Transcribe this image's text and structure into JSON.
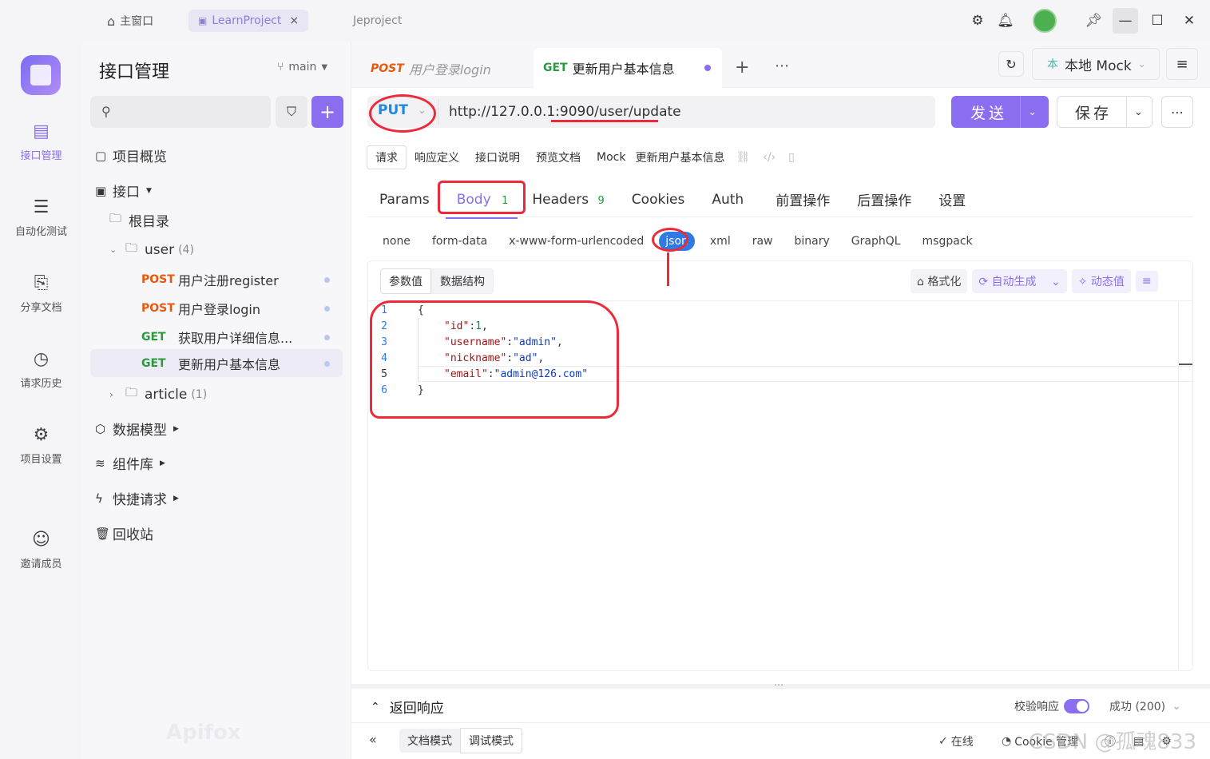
{
  "topbar": {
    "home_label": "主窗口",
    "project_tab": "LearnProject",
    "project_tab_close": "×",
    "project_name": "Jeproject"
  },
  "rail": [
    {
      "label": "接口管理",
      "icon": "api-management-icon"
    },
    {
      "label": "自动化测试",
      "icon": "automation-icon"
    },
    {
      "label": "分享文档",
      "icon": "share-doc-icon"
    },
    {
      "label": "请求历史",
      "icon": "history-icon"
    },
    {
      "label": "项目设置",
      "icon": "settings-icon"
    },
    {
      "label": "邀请成员",
      "icon": "invite-icon"
    }
  ],
  "sidebar": {
    "title": "接口管理",
    "branch": "main",
    "overview": "项目概览",
    "interfaces": "接口",
    "root": "根目录",
    "user_folder": "user",
    "user_count": "(4)",
    "items": [
      {
        "method": "POST",
        "name": "用户注册register"
      },
      {
        "method": "POST",
        "name": "用户登录login"
      },
      {
        "method": "GET",
        "name": "获取用户详细信息..."
      },
      {
        "method": "GET",
        "name": "更新用户基本信息"
      }
    ],
    "article_folder": "article",
    "article_count": "(1)",
    "data_models": "数据模型",
    "components": "组件库",
    "quick_requests": "快捷请求",
    "recycle": "回收站",
    "watermark": "Apifox"
  },
  "tabs": {
    "tab1_method": "POST",
    "tab1_name": "用户登录login",
    "tab2_method": "GET",
    "tab2_name": "更新用户基本信息",
    "env": "本地 Mock"
  },
  "request": {
    "method": "PUT",
    "url": "http://127.0.0.1:9090/user/update",
    "send": "发送",
    "save": "保存"
  },
  "subtabs": [
    "请求",
    "响应定义",
    "接口说明",
    "预览文档",
    "Mock"
  ],
  "subtabs_title": "更新用户基本信息",
  "param_tabs": {
    "params": "Params",
    "body": "Body",
    "body_count": "1",
    "headers": "Headers",
    "headers_count": "9",
    "cookies": "Cookies",
    "auth": "Auth",
    "pre": "前置操作",
    "post": "后置操作",
    "settings": "设置"
  },
  "body_types": [
    "none",
    "form-data",
    "x-www-form-urlencoded",
    "json",
    "xml",
    "raw",
    "binary",
    "GraphQL",
    "msgpack"
  ],
  "editor": {
    "tab_values": "参数值",
    "tab_schema": "数据结构",
    "format": "格式化",
    "autogen": "自动生成",
    "dynamic": "动态值",
    "lines": [
      {
        "n": "1",
        "text": "{"
      },
      {
        "n": "2",
        "key": "\"id\"",
        "val": "1",
        "tail": ","
      },
      {
        "n": "3",
        "key": "\"username\"",
        "val": "\"admin\"",
        "tail": ","
      },
      {
        "n": "4",
        "key": "\"nickname\"",
        "val": "\"ad\"",
        "tail": ","
      },
      {
        "n": "5",
        "key": "\"email\"",
        "val": "\"admin@126.com\"",
        "tail": ""
      },
      {
        "n": "6",
        "text": "}"
      }
    ]
  },
  "response": {
    "title": "返回响应",
    "validate": "校验响应",
    "status": "成功 (200)"
  },
  "footer": {
    "doc_mode": "文档模式",
    "debug_mode": "调试模式",
    "online": "在线",
    "cookie": "Cookie 管理",
    "watermark": "CSDN @孤魂833"
  },
  "colors": {
    "accent": "#8b6ef0",
    "post": "#e8590c",
    "get": "#2b9a3e",
    "annotation": "#ee2a3a"
  }
}
